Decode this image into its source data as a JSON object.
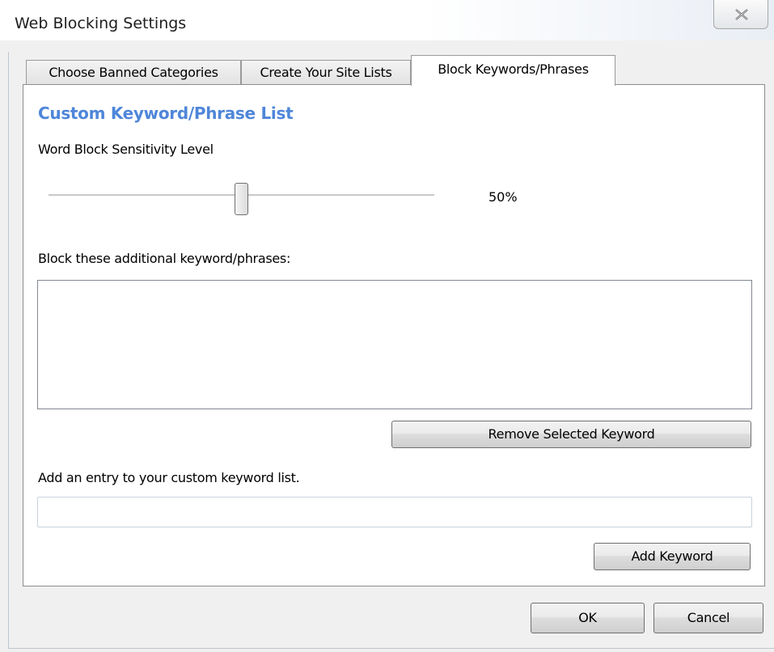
{
  "window": {
    "title": "Web Blocking Settings"
  },
  "tabs": [
    {
      "label": "Choose Banned Categories",
      "active": false
    },
    {
      "label": "Create Your Site Lists",
      "active": false
    },
    {
      "label": "Block Keywords/Phrases",
      "active": true
    }
  ],
  "keywords_page": {
    "heading": "Custom Keyword/Phrase List",
    "sensitivity_label": "Word Block Sensitivity Level",
    "sensitivity_value": "50%",
    "sensitivity_level": 0.5,
    "block_list_label": "Block these additional keyword/phrases:",
    "block_list_items": [],
    "remove_button_label": "Remove Selected Keyword",
    "add_entry_label": "Add an entry to your custom keyword list.",
    "add_entry_value": "",
    "add_button_label": "Add Keyword"
  },
  "dialog_buttons": {
    "ok_label": "OK",
    "cancel_label": "Cancel"
  },
  "colors": {
    "heading": "#4f86d9",
    "background": "#f0f0f0",
    "panel": "#ffffff"
  },
  "icons": {
    "close": "close-icon"
  }
}
